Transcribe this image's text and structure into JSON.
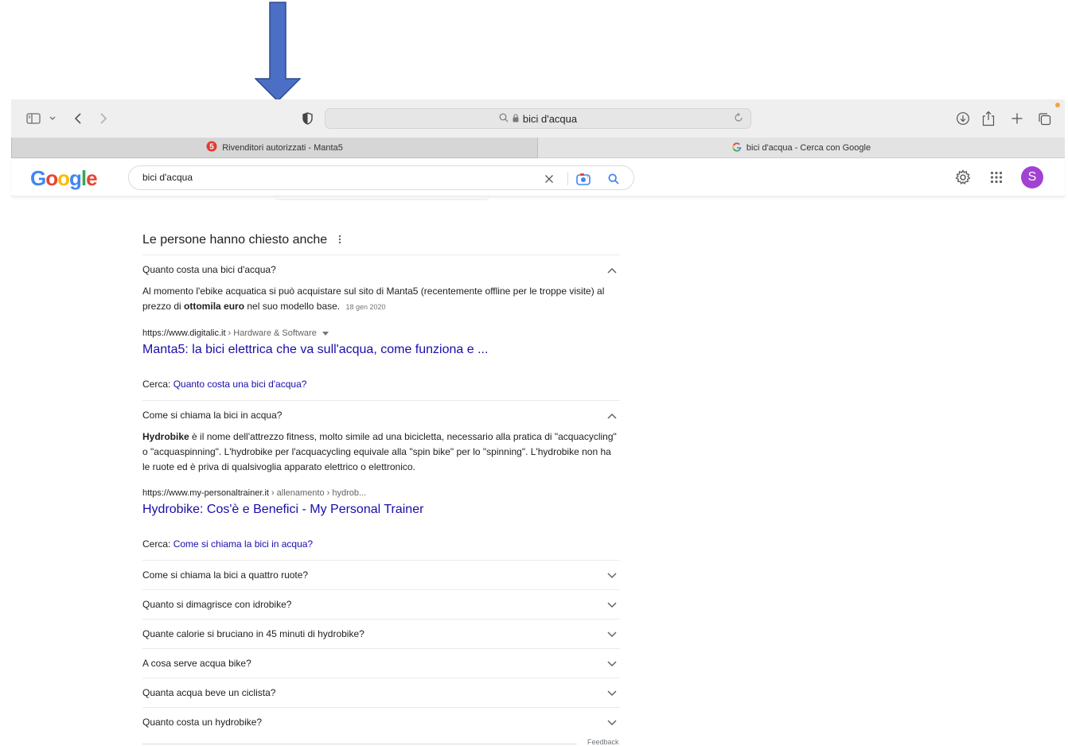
{
  "browser": {
    "address_text": "bici d'acqua",
    "tabs": [
      {
        "label": "Rivenditori autorizzati - Manta5",
        "favicon": "manta5-badge",
        "active": true
      },
      {
        "label": "bici d'acqua - Cerca con Google",
        "favicon": "google-g",
        "active": false
      }
    ],
    "accent_dot_color": "#f5a142"
  },
  "google": {
    "logo_text": "Google",
    "logo_colors": [
      "#4285f4",
      "#ea4335",
      "#fbbc05",
      "#4285f4",
      "#34a853",
      "#ea4335"
    ],
    "search_value": "bici d'acqua",
    "avatar_letter": "S",
    "avatar_color": "#a142d2"
  },
  "paa": {
    "title": "Le persone hanno chiesto anche",
    "expanded": [
      {
        "question": "Quanto costa una bici d'acqua?",
        "answer_pre": "Al momento l'ebike acquatica si può acquistare sul sito di Manta5 (recentemente offline per le troppe visite) al prezzo di ",
        "answer_bold": "ottomila euro",
        "answer_post": " nel suo modello base.",
        "date": "18 gen 2020",
        "source_url": "https://www.digitalic.it",
        "source_crumbs": "› Hardware & Software",
        "result_title": "Manta5: la bici elettrica che va sull'acqua, come funziona e ...",
        "cerca_label": "Cerca:",
        "cerca_link": "Quanto costa una bici d'acqua?"
      },
      {
        "question": "Come si chiama la bici in acqua?",
        "answer_bold": "Hydrobike",
        "answer_post": " è il nome dell'attrezzo fitness, molto simile ad una bicicletta, necessario alla pratica di \"acquacycling\" o \"acquaspinning\". L'hydrobike per l'acquacycling equivale alla \"spin bike\" per lo \"spinning\". L'hydrobike non ha le ruote ed è priva di qualsivoglia apparato elettrico o elettronico.",
        "source_url": "https://www.my-personaltrainer.it",
        "source_crumbs": "› allenamento › hydrob...",
        "result_title": "Hydrobike: Cos'è e Benefici - My Personal Trainer",
        "cerca_label": "Cerca:",
        "cerca_link": "Come si chiama la bici in acqua?"
      }
    ],
    "collapsed": [
      "Come si chiama la bici a quattro ruote?",
      "Quanto si dimagrisce con idrobike?",
      "Quante calorie si bruciano in 45 minuti di hydrobike?",
      "A cosa serve acqua bike?",
      "Quanta acqua beve un ciclista?",
      "Quanto costa un hydrobike?"
    ],
    "feedback": "Feedback"
  }
}
